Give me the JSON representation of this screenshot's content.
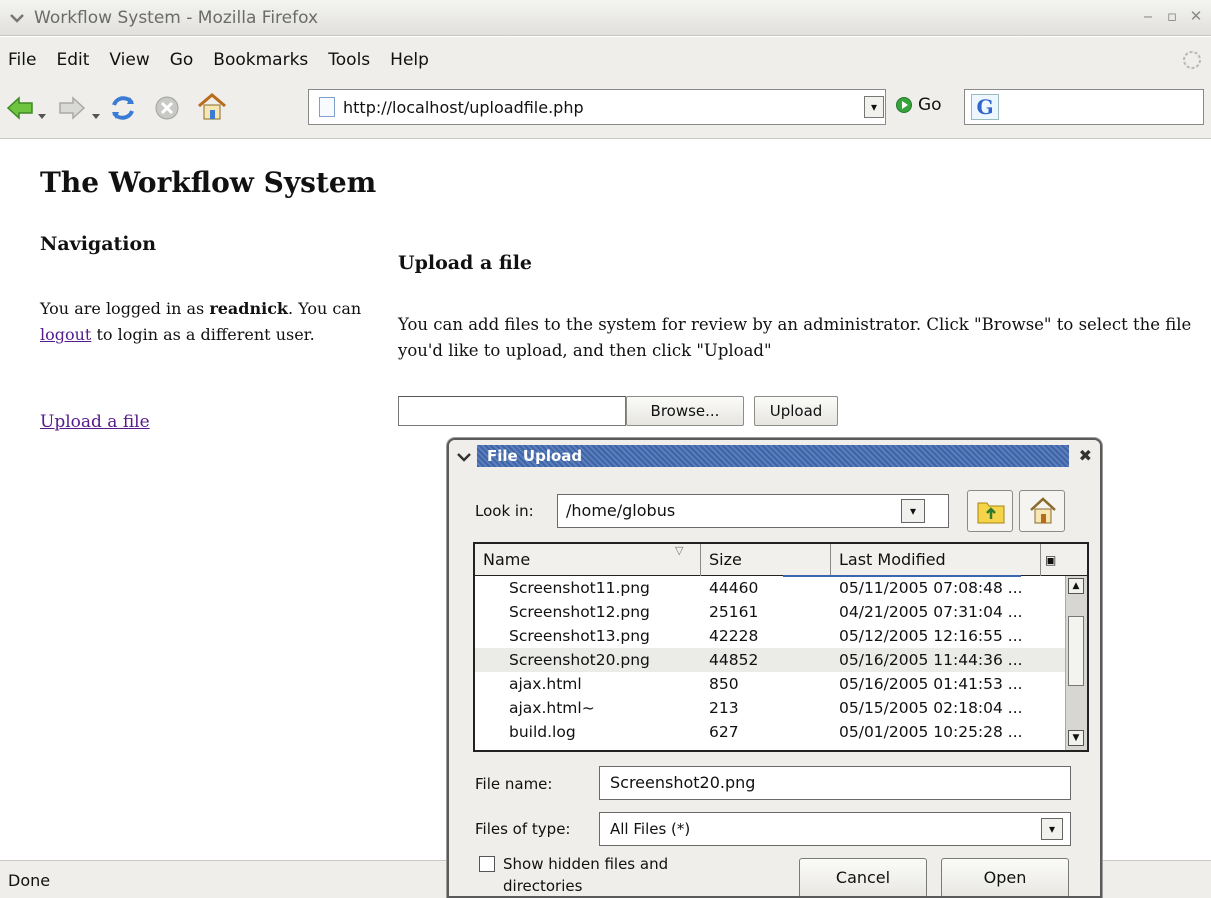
{
  "window": {
    "title": "Workflow System - Mozilla Firefox"
  },
  "menubar": {
    "items": [
      "File",
      "Edit",
      "View",
      "Go",
      "Bookmarks",
      "Tools",
      "Help"
    ]
  },
  "navbar": {
    "url": "http://localhost/uploadfile.php",
    "go_label": "Go",
    "search_value": "",
    "icons": [
      "back-arrow-icon",
      "forward-arrow-icon",
      "reload-icon",
      "stop-icon",
      "home-icon"
    ]
  },
  "page": {
    "title": "The Workflow System",
    "nav_heading": "Navigation",
    "login_prefix": "You are logged in as ",
    "username": "readnick",
    "login_mid": ". You can ",
    "logout_link": "logout",
    "login_suffix": " to login as a different user.",
    "upload_link": "Upload a file",
    "upload_heading": "Upload a file",
    "upload_description": "You can add files to the system for review by an administrator. Click \"Browse\" to select the file you'd like to upload, and then click \"Upload\"",
    "file_input_value": "",
    "browse_label": "Browse...",
    "upload_label": "Upload"
  },
  "status": {
    "text": "Done"
  },
  "dialog": {
    "title": "File Upload",
    "look_in_label": "Look in:",
    "look_in_value": "/home/globus",
    "columns": {
      "name": "Name",
      "size": "Size",
      "modified": "Last Modified"
    },
    "files": [
      {
        "name": "Screenshot11.png",
        "size": "44460",
        "modified": "05/11/2005 07:08:48 ..."
      },
      {
        "name": "Screenshot12.png",
        "size": "25161",
        "modified": "04/21/2005 07:31:04 ..."
      },
      {
        "name": "Screenshot13.png",
        "size": "42228",
        "modified": "05/12/2005 12:16:55 ..."
      },
      {
        "name": "Screenshot20.png",
        "size": "44852",
        "modified": "05/16/2005 11:44:36 ...",
        "selected": true
      },
      {
        "name": "ajax.html",
        "size": "850",
        "modified": "05/16/2005 01:41:53 ..."
      },
      {
        "name": "ajax.html~",
        "size": "213",
        "modified": "05/15/2005 02:18:04 ..."
      },
      {
        "name": "build.log",
        "size": "627",
        "modified": "05/01/2005 10:25:28 ..."
      }
    ],
    "file_name_label": "File name:",
    "file_name_value": "Screenshot20.png",
    "files_of_type_label": "Files of type:",
    "files_of_type_value": "All Files (*)",
    "show_hidden_label": "Show hidden files and directories",
    "cancel_label": "Cancel",
    "open_label": "Open"
  },
  "colors": {
    "dialog_title_band": "#3f63a4",
    "visited_link": "#551a8b",
    "chrome_background": "#efeeea"
  }
}
